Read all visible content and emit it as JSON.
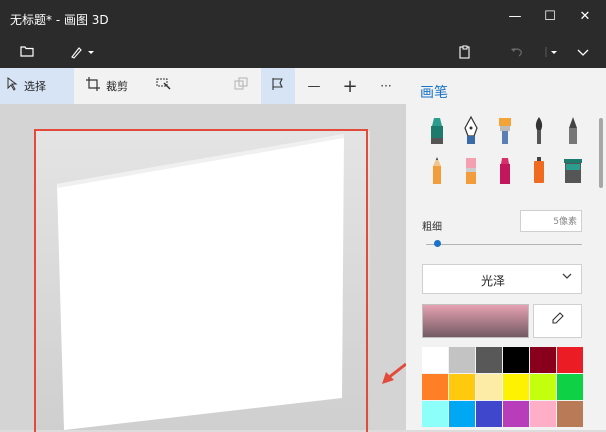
{
  "window": {
    "title": "无标题* - 画图 3D",
    "minimize_glyph": "—",
    "maximize_glyph": "☐",
    "close_glyph": "✕"
  },
  "menubar": {
    "folder_icon": "folder-icon",
    "brush_icon": "brush-menu-icon",
    "paste_icon": "paste-icon",
    "undo_icon": "undo-icon",
    "more_icon": "more-dropdown-icon",
    "chevron_icon": "chevron-down-icon"
  },
  "toolbar": {
    "select_label": "选择",
    "crop_label": "裁剪",
    "magic_icon": "magic-select-icon",
    "copy_icon": "copy-icon",
    "flag_icon": "flag-icon",
    "minus_glyph": "—",
    "plus_glyph": "+",
    "more_glyph": "···"
  },
  "panel": {
    "title": "画笔",
    "brush_icons": [
      "marker",
      "calligraphy-pen",
      "oil-brush",
      "watercolor",
      "pixel-pen",
      "pencil",
      "eraser",
      "crayon",
      "spray-can",
      "fill-bucket"
    ],
    "thickness_label": "粗细",
    "thickness_value": "5像素",
    "thickness_level": 0.05,
    "finish_label": "光泽",
    "colors": {
      "current_top": "#e6a1b1",
      "current_bottom": "#725a63",
      "palette": [
        "#ffffff",
        "#c3c3c3",
        "#585858",
        "#000000",
        "#88001b",
        "#ec1c24",
        "#ff7f27",
        "#ffc90e",
        "#fdeca6",
        "#fff200",
        "#c4ff0e",
        "#0ed145",
        "#8cfffb",
        "#00a8f3",
        "#3f48cc",
        "#b83dba",
        "#ffaec8",
        "#b97a57"
      ]
    }
  }
}
